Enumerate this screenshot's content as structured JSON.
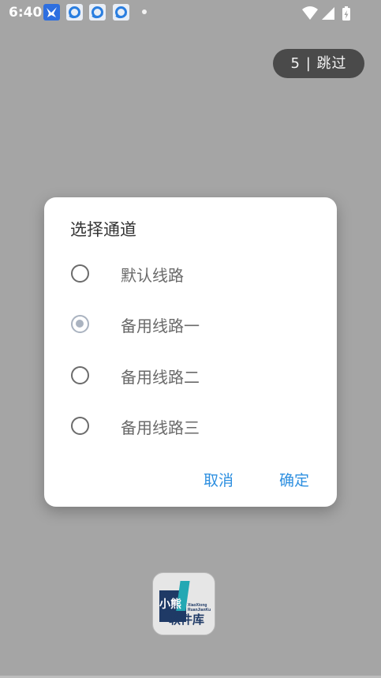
{
  "status_bar": {
    "time": "6:40",
    "icons": [
      "bird-app-icon",
      "browser-notification-icon",
      "browser-notification-icon",
      "browser-notification-icon",
      "wifi-icon",
      "signal-icon",
      "battery-charging-icon"
    ]
  },
  "skip_button": {
    "label": "5 | 跳过"
  },
  "dialog": {
    "title": "选择通道",
    "options": [
      {
        "label": "默认线路",
        "selected": false
      },
      {
        "label": "备用线路一",
        "selected": true
      },
      {
        "label": "备用线路二",
        "selected": false
      },
      {
        "label": "备用线路三",
        "selected": false
      }
    ],
    "cancel_label": "取消",
    "confirm_label": "确定"
  },
  "logo": {
    "text_main": "小熊",
    "text_sub": "软件库",
    "text_small_1": "XiaoXiong",
    "text_small_2": "RuanJianKu"
  },
  "colors": {
    "overlay": "#a5a5a5",
    "accent": "#2d8fe0",
    "skip_bg": "#4a4a4a"
  }
}
